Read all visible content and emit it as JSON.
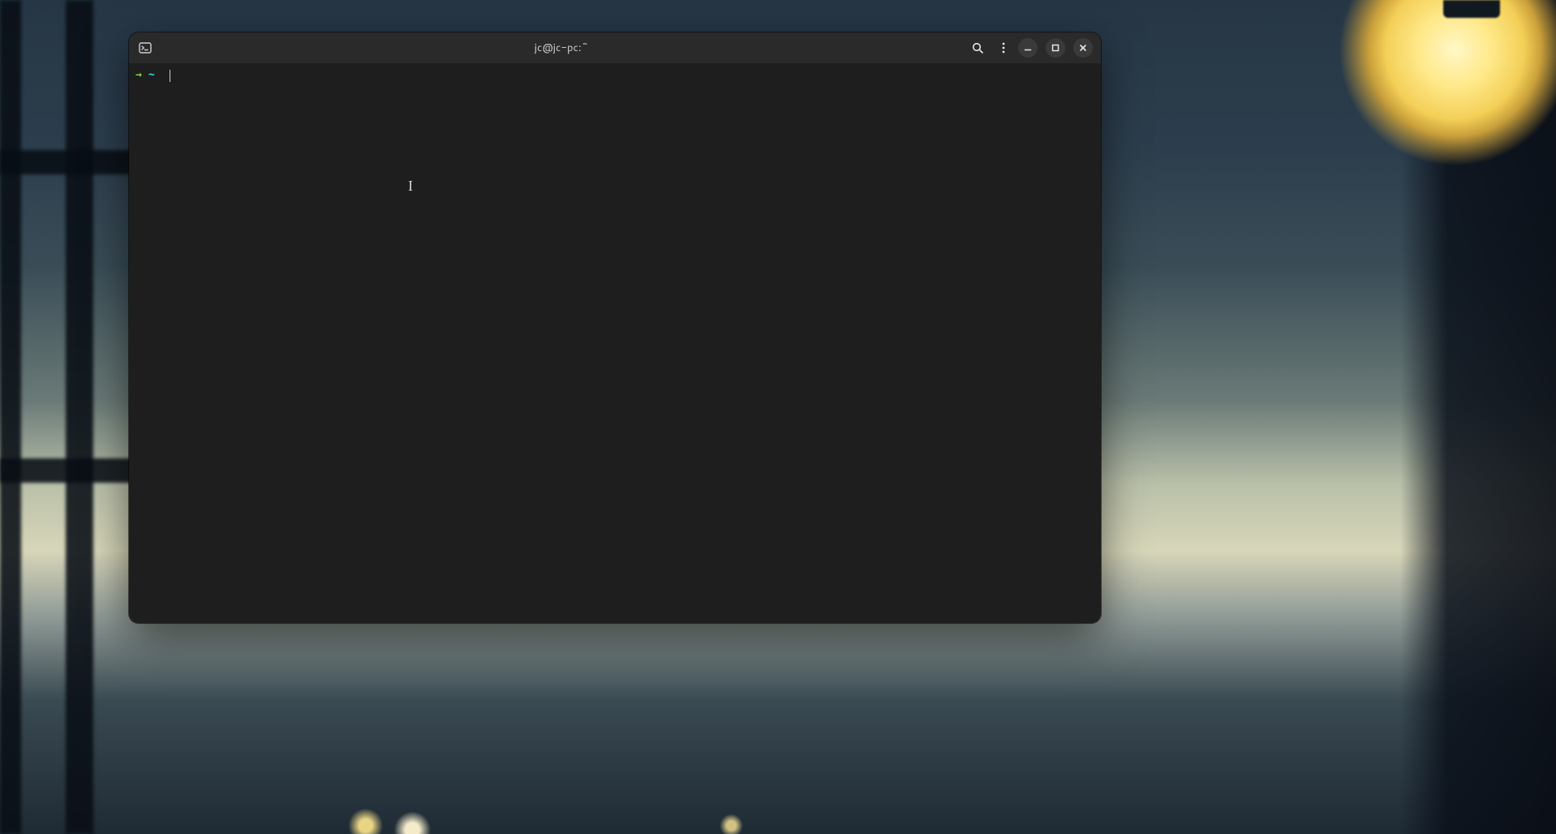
{
  "window": {
    "title": "jc@jc-pc:~",
    "app_icon_name": "terminal-app-icon"
  },
  "titlebar_buttons": {
    "search": "search-icon",
    "menu": "kebab-menu-icon",
    "minimize": "minimize-icon",
    "maximize": "maximize-icon",
    "close": "close-icon"
  },
  "prompt": {
    "arrow": "→",
    "cwd": "~",
    "input_value": ""
  },
  "colors": {
    "terminal_bg": "#1e1e1e",
    "titlebar_bg": "#2a2a2a",
    "prompt_arrow": "#8ae234",
    "prompt_cwd": "#34e2e2",
    "text": "#d0d0d0"
  },
  "cursor_pointer_glyph": "I"
}
